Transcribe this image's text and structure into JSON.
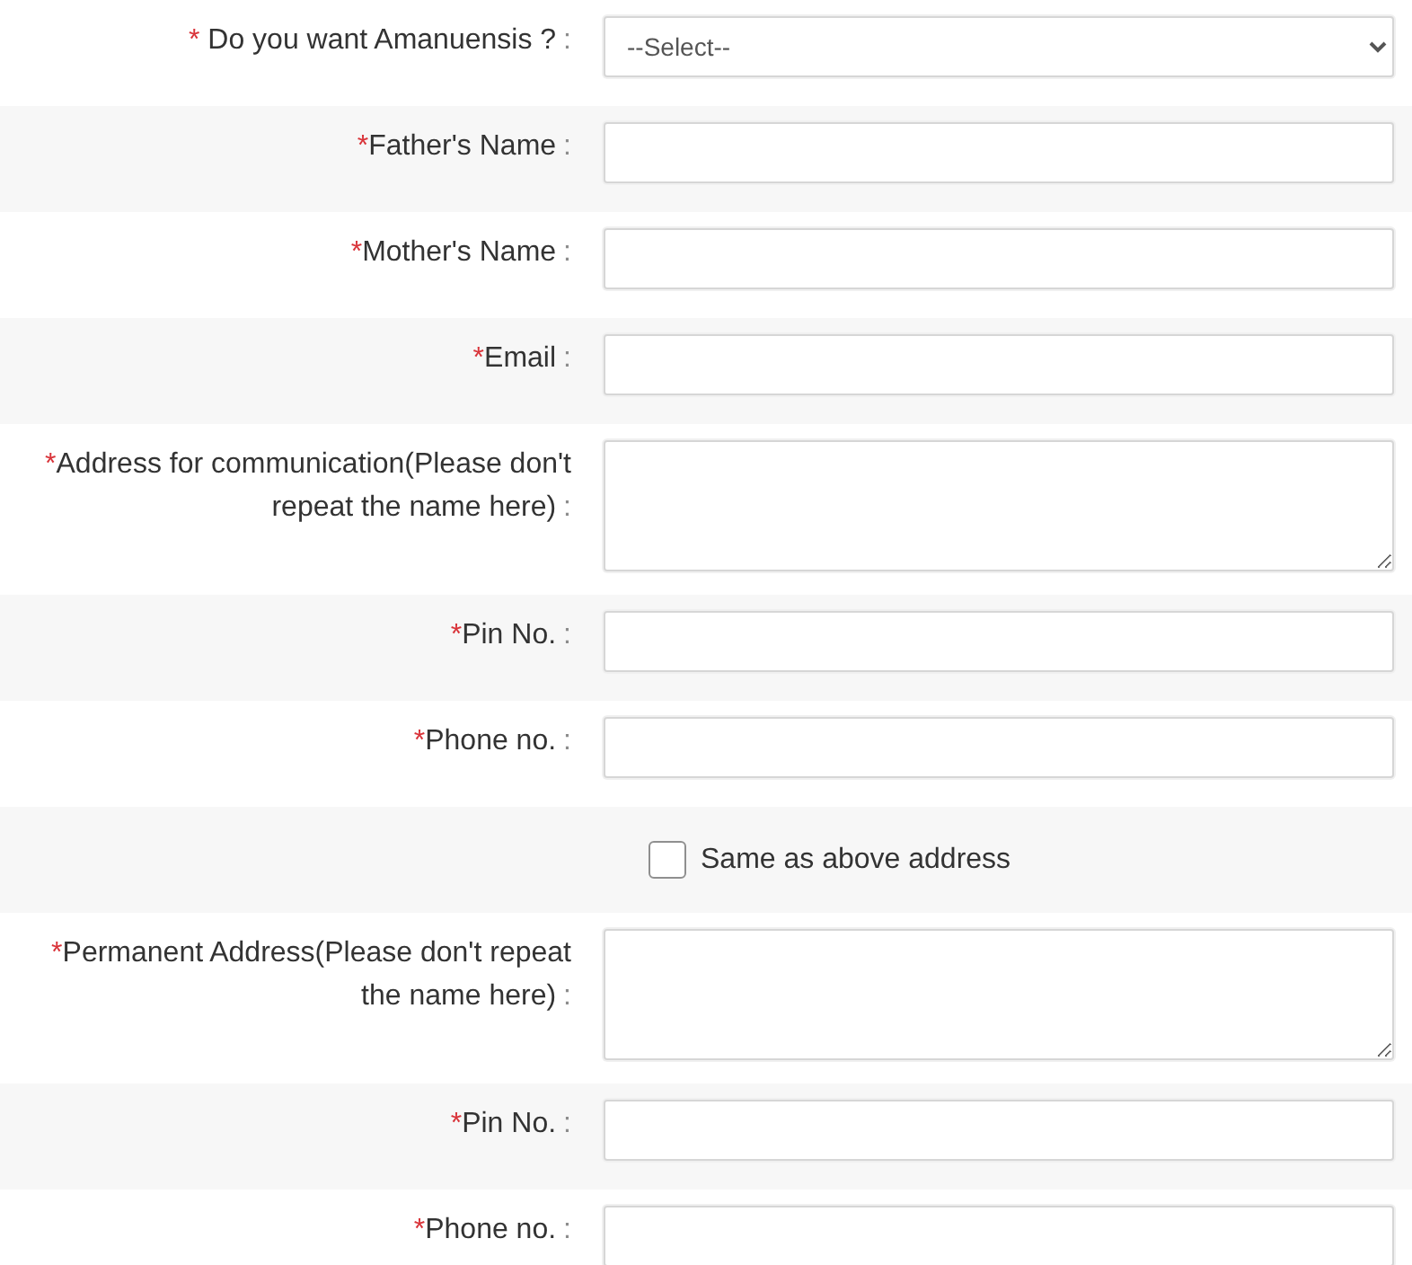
{
  "form": {
    "rows": [
      {
        "kind": "select",
        "mark": "* ",
        "label": "Do you want Amanuensis ?",
        "separator": ":",
        "value": "--Select--"
      },
      {
        "kind": "text",
        "mark": "*",
        "label": "Father's Name",
        "separator": ":"
      },
      {
        "kind": "text",
        "mark": "*",
        "label": "Mother's Name",
        "separator": ":"
      },
      {
        "kind": "text",
        "mark": "*",
        "label": "Email",
        "separator": ":"
      },
      {
        "kind": "textarea",
        "mark": "*",
        "label": "Address for communication(Please don't repeat the name here)",
        "separator": ":"
      },
      {
        "kind": "text",
        "mark": "*",
        "label": "Pin No.",
        "separator": ":"
      },
      {
        "kind": "text",
        "mark": "*",
        "label": "Phone no.",
        "separator": ":"
      },
      {
        "kind": "checkbox",
        "label": "Same as above address",
        "checked": false
      },
      {
        "kind": "textarea",
        "mark": "*",
        "label": "Permanent Address(Please don't repeat the name here)",
        "separator": ":"
      },
      {
        "kind": "text",
        "mark": "*",
        "label": "Pin No.",
        "separator": ":"
      },
      {
        "kind": "text",
        "mark": "*",
        "label": "Phone no.",
        "separator": ":"
      }
    ]
  }
}
